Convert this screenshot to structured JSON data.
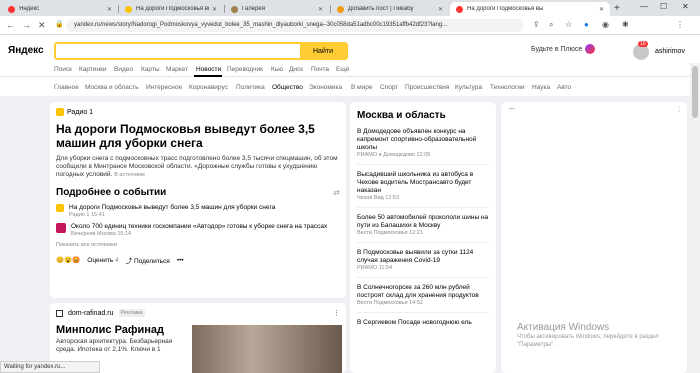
{
  "browser": {
    "tabs": [
      {
        "title": "Яндекс",
        "color": "#f33",
        "active": false
      },
      {
        "title": "На дороги Подмосковья вы",
        "color": "#f9c300",
        "active": false
      },
      {
        "title": "Галерея",
        "color": "#9c7f4b",
        "active": false
      },
      {
        "title": "Добавить пост | Пикабу",
        "color": "#f39c12",
        "active": false
      },
      {
        "title": "На дороги Подмосковья вы",
        "color": "#f33",
        "active": true
      }
    ],
    "new_tab": "+",
    "url": "yandex.ru/news/story/Nadorogi_Podmoskovya_vyvedut_bolee_35_mashin_dlyauborki_snega--30c058da51adbc00c19351affb42df23?lang...",
    "status": "Waiting for yandex.ru..."
  },
  "header": {
    "logo": "Яндекс",
    "search_button": "Найти",
    "plus_label": "Будьте в Плюсе",
    "notif_count": "10",
    "username": "ashirimov"
  },
  "services": [
    "Поиск",
    "Картинки",
    "Видео",
    "Карты",
    "Маркет",
    "Новости",
    "Переводчик",
    "Кью",
    "Диск",
    "Почта",
    "Ещё"
  ],
  "active_service": "Новости",
  "rubrics": [
    "Главное",
    "Москва и область",
    "Интересное",
    "Коронавирус",
    "Политика",
    "Общество",
    "Экономика",
    "В мире",
    "Спорт",
    "Происшествия",
    "Культура",
    "Технологии",
    "Наука",
    "Авто"
  ],
  "active_rubric": "Общество",
  "story": {
    "source": "Радио 1",
    "title": "На дороги Подмосковья выведут более 3,5 машин для уборки снега",
    "text": "Для уборки снега с подмосковных трасс подготовлено более 3,5 тысячи спецмашин, об этом сообщили в Минтрансе Московской области. «Дорожные службы готовы к ухудшению погодных условий.",
    "source_link": "В источнике",
    "details_heading": "Подробнее о событии",
    "related": [
      {
        "title": "На дороги Подмосковья выведут более 3,5 машин для уборки снега",
        "meta": "Радио 1 15:41",
        "color": "#f9c300"
      },
      {
        "title": "Около 700 единиц техники госкомпании «Автодор» готовы к уборке снега на трассах",
        "meta": "Вечерняя Москва 15:14",
        "color": "#c2185b"
      }
    ],
    "show_all": "Показать все источники",
    "rate_label": "Оценить",
    "rate_count": "4",
    "share_label": "Поделиться",
    "more": "•••"
  },
  "ad": {
    "domain": "dom-rafinad.ru",
    "badge": "Реклама",
    "title": "Минполис Рафинад",
    "text": "Авторская архитектура. Безбарьерная среда. Ипотека от 2,1%. Ключи в 1"
  },
  "moscow": {
    "heading": "Москва и область",
    "items": [
      {
        "title": "В Домодедове объявлен конкурс на капремонт спортивно-образовательной школы",
        "meta": "РИАМО в Домодедово 12:05"
      },
      {
        "title": "Высадивший школьника из автобуса в Чехове водитель Мострансавто будет наказан",
        "meta": "Чехов Вид 12:53"
      },
      {
        "title": "Более 50 автомобилей прокололи шины на пути из Балашихи в Москву",
        "meta": "Вести Подмосковья 12:21"
      },
      {
        "title": "В Подмосковье выявили за сутки 1124 случая заражения Covid-19",
        "meta": "РИАМО 11:54"
      },
      {
        "title": "В Солнечногорске за 260 млн рублей построят склад для хранения продуктов",
        "meta": "Вести Подмосковья 14:52"
      },
      {
        "title": "В Сергиевом Посаде новогоднюю ель",
        "meta": ""
      }
    ]
  },
  "windows_activation": {
    "title": "Активация Windows",
    "text": "Чтобы активировать Windows, перейдите в раздел \"Параметры\"."
  }
}
